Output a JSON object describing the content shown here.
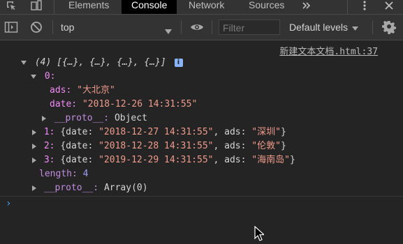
{
  "tabs": {
    "items": [
      {
        "label": "Elements"
      },
      {
        "label": "Console"
      },
      {
        "label": "Network"
      },
      {
        "label": "Sources"
      }
    ],
    "more_icon": "chevron-double-right-icon",
    "menu_icon": "kebab-menu-icon",
    "close_icon": "close-icon"
  },
  "toolbar": {
    "context_label": "top",
    "filter_placeholder": "Filter",
    "levels_label": "Default levels"
  },
  "console": {
    "source_link": "新建文本文档.html:37",
    "array_summary": "(4) [{…}, {…}, {…}, {…}]",
    "item0_index": "0:",
    "item0_ads_key": "ads:",
    "item0_ads_value": "\"大北京\"",
    "item0_date_key": "date:",
    "item0_date_value": "\"2018-12-26 14:31:55\"",
    "item0_proto_key": "__proto__:",
    "item0_proto_value": "Object",
    "item1_index": "1:",
    "item1_date_value": "\"2018-12-27 14:31:55\"",
    "item1_ads_value": "\"深圳\"",
    "item2_index": "2:",
    "item2_date_value": "\"2018-12-28 14:31:55\"",
    "item2_ads_value": "\"伦敦\"",
    "item3_index": "3:",
    "item3_date_value": "\"2019-12-29 14:31:55\"",
    "item3_ads_value": "\"海南岛\"",
    "date_key": "date:",
    "ads_key": "ads:",
    "length_key": "length:",
    "length_value": "4",
    "proto_key": "__proto__:",
    "proto_value": "Array(0)",
    "prompt_symbol": "›"
  },
  "colors": {
    "background": "#242424",
    "toolbar": "#333333",
    "string": "#f09b8b",
    "key": "#f28bf8",
    "accent": "#8ab4f8"
  }
}
